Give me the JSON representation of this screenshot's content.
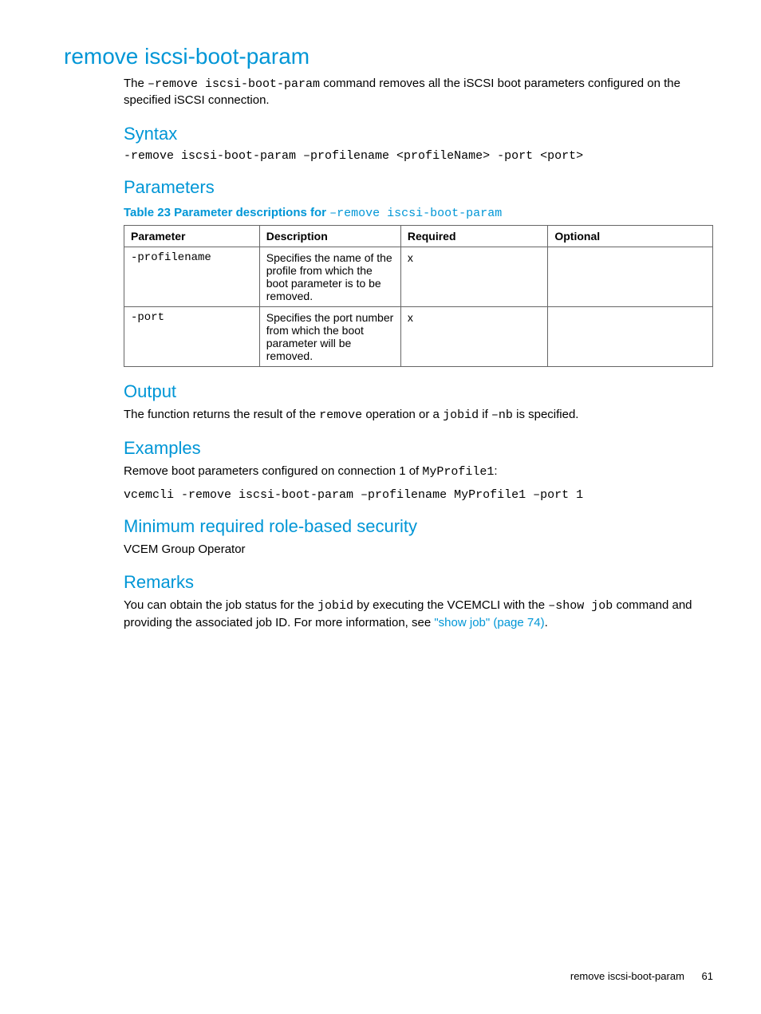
{
  "title": "remove iscsi-boot-param",
  "intro_pre": "The ",
  "intro_code": "–remove iscsi-boot-param",
  "intro_post": " command removes all the iSCSI boot parameters configured on the specified iSCSI connection.",
  "syntax": {
    "heading": "Syntax",
    "text": "-remove iscsi-boot-param –profilename <profileName> -port <port>"
  },
  "parameters": {
    "heading": "Parameters",
    "caption_prefix": "Table 23 Parameter descriptions for ",
    "caption_code": "–remove iscsi-boot-param",
    "headers": {
      "param": "Parameter",
      "desc": "Description",
      "required": "Required",
      "optional": "Optional"
    },
    "rows": [
      {
        "param": "-profilename",
        "desc": "Specifies the name of the profile from which the boot parameter is to be removed.",
        "required": "x",
        "optional": ""
      },
      {
        "param": "-port",
        "desc": "Specifies the port number from which the boot parameter will be removed.",
        "required": "x",
        "optional": ""
      }
    ]
  },
  "output": {
    "heading": "Output",
    "pre1": "The function returns the result of the ",
    "code1": "remove",
    "mid1": " operation or a ",
    "code2": "jobid",
    "mid2": " if ",
    "code3": "–nb",
    "post": " is specified."
  },
  "examples": {
    "heading": "Examples",
    "intro_pre": "Remove boot parameters configured on connection 1 of ",
    "intro_code": "MyProfile1",
    "intro_post": ":",
    "command": "vcemcli -remove iscsi-boot-param –profilename MyProfile1 –port 1"
  },
  "security": {
    "heading": "Minimum required role-based security",
    "text": "VCEM Group Operator"
  },
  "remarks": {
    "heading": "Remarks",
    "pre1": "You can obtain the job status for the ",
    "code1": "jobid",
    "mid1": " by executing the VCEMCLI with the ",
    "code2": "–show job",
    "mid2": " command and providing the associated job ID. For more information, see ",
    "link": "\"show job\" (page 74)",
    "post": "."
  },
  "footer": {
    "label": "remove iscsi-boot-param",
    "page": "61"
  }
}
